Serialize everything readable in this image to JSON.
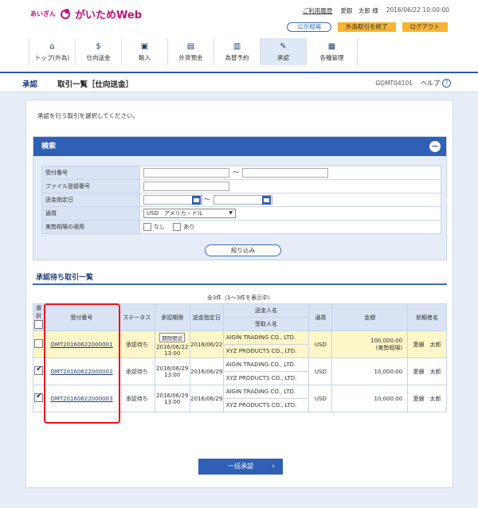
{
  "brand": {
    "small": "あいぎん",
    "main": "がいためWeb"
  },
  "util": {
    "history": "ご利用履歴",
    "user": "愛銀　太郎 様",
    "datetime": "2016/06/22 10:00:00"
  },
  "buttons": {
    "rates": "公示相場",
    "end_fx": "外為取引を終了",
    "logout": "ログアウト"
  },
  "gnav": [
    {
      "label": "トップ(外為)",
      "icon": "⌂"
    },
    {
      "label": "仕向送金",
      "icon": "$"
    },
    {
      "label": "輸入",
      "icon": "▣"
    },
    {
      "label": "外貨預金",
      "icon": "▤"
    },
    {
      "label": "為替予約",
      "icon": "▥"
    },
    {
      "label": "承認",
      "icon": "✎"
    },
    {
      "label": "各種管理",
      "icon": "▦"
    }
  ],
  "titlebar": {
    "category": "承認",
    "title": "取引一覧［仕向送金］",
    "code": "GOMT04101",
    "help": "ヘルプ",
    "help_icon": "?"
  },
  "instruction": "承認を行う取引を選択してください。",
  "search": {
    "title": "検索",
    "toggle": "−",
    "fields": {
      "receipt_no": "受付番号",
      "file_no": "ファイル登録番号",
      "date": "送金指定日",
      "currency": "通貨",
      "fx_rate": "実勢相場の適用"
    },
    "tilde": "〜",
    "currency_value": "USD　アメリカ・ドル",
    "opt_none": "なし",
    "opt_yes": "あり",
    "submit": "絞り込み"
  },
  "list": {
    "title": "承認待ち取引一覧",
    "count": "全3件（1〜3件を表示中）",
    "headers": {
      "select": "選択",
      "receipt": "受付番号",
      "status": "ステータス",
      "deadline": "承認期限",
      "date": "送金指定日",
      "remitter": "送金人名",
      "beneficiary": "受取人名",
      "currency": "通貨",
      "amount": "金額",
      "requester": "依頼者名"
    },
    "rows": [
      {
        "checked": false,
        "no": "OMT20160622000001",
        "status": "承認待ち",
        "badge": "期限間近",
        "deadline_date": "2016/06/22",
        "deadline_time": "13:00",
        "date": "2016/06/22",
        "remitter": "AIGIN TRADING CO., LTD.",
        "beneficiary": "XYZ PRODUCTS CO., LTD.",
        "currency": "USD",
        "amount": "100,000.00",
        "note": "(実勢相場)",
        "requester": "愛銀　太郎"
      },
      {
        "checked": true,
        "no": "OMT20160622000002",
        "status": "承認待ち",
        "badge": "",
        "deadline_date": "2016/06/29",
        "deadline_time": "13:00",
        "date": "2016/06/29",
        "remitter": "AIGIN TRADING CO., LTD.",
        "beneficiary": "XYZ PRODUCTS CO., LTD.",
        "currency": "USD",
        "amount": "10,000.00",
        "note": "",
        "requester": "愛銀　太郎"
      },
      {
        "checked": true,
        "no": "OMT20160622000003",
        "status": "承認待ち",
        "badge": "",
        "deadline_date": "2016/06/29",
        "deadline_time": "13:00",
        "date": "2016/06/29",
        "remitter": "AIGIN TRADING CO., LTD.",
        "beneficiary": "XYZ PRODUCTS CO., LTD.",
        "currency": "USD",
        "amount": "10,000.00",
        "note": "",
        "requester": "愛銀　太郎"
      }
    ]
  },
  "bulk": {
    "label": "一括承認",
    "chevron": "›"
  }
}
